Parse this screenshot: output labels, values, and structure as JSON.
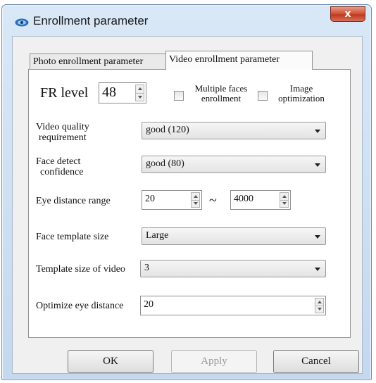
{
  "window": {
    "title": "Enrollment parameter",
    "close_glyph": "x"
  },
  "tabs": [
    {
      "label": "Photo enrollment parameter",
      "selected": false
    },
    {
      "label": "Video enrollment parameter",
      "selected": true
    }
  ],
  "form": {
    "fr_level": {
      "label": "FR level",
      "value": "48"
    },
    "multiple_faces": {
      "label_line1": "Multiple faces",
      "label_line2": "enrollment",
      "checked": false
    },
    "image_optimization": {
      "label_line1": "Image",
      "label_line2": "optimization",
      "checked": false
    },
    "video_quality": {
      "label_line1": "Video quality",
      "label_line2": "requirement",
      "value": "good (120)"
    },
    "face_confidence": {
      "label_line1": "Face detect",
      "label_line2": "confidence",
      "value": "good (80)"
    },
    "eye_distance": {
      "label": "Eye distance range",
      "min": "20",
      "separator": "~",
      "max": "4000"
    },
    "face_template_size": {
      "label": "Face template size",
      "value": "Large"
    },
    "template_size_video": {
      "label": "Template size of video",
      "value": "3"
    },
    "optimize_eye_distance": {
      "label": "Optimize eye distance",
      "value": "20"
    }
  },
  "buttons": {
    "ok": "OK",
    "apply": "Apply",
    "cancel": "Cancel"
  },
  "icons": {
    "app": "app-eye-icon",
    "close": "close-icon"
  },
  "colors": {
    "close_button": "#c9442a",
    "title_bar": "#c9dcf1"
  }
}
